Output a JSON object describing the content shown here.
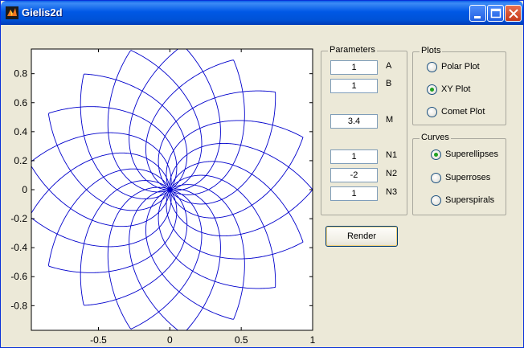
{
  "window": {
    "title": "Gielis2d"
  },
  "parameters": {
    "legend": "Parameters",
    "fields": [
      {
        "label": "A",
        "value": "1"
      },
      {
        "label": "B",
        "value": "1"
      },
      {
        "label": "M",
        "value": "3.4"
      },
      {
        "label": "N1",
        "value": "1"
      },
      {
        "label": "N2",
        "value": "-2"
      },
      {
        "label": "N3",
        "value": "1"
      }
    ]
  },
  "plots": {
    "legend": "Plots",
    "options": [
      "Polar Plot",
      "XY Plot",
      "Comet Plot"
    ],
    "selected": "XY Plot"
  },
  "curves": {
    "legend": "Curves",
    "options": [
      "Superellipses",
      "Superroses",
      "Superspirals"
    ],
    "selected": "Superellipses"
  },
  "render_label": "Render",
  "chart_data": {
    "type": "line",
    "title": "",
    "xlabel": "",
    "ylabel": "",
    "xlim": [
      -0.97,
      1.0
    ],
    "ylim": [
      -0.97,
      0.97
    ],
    "xticks": [
      "-0.5",
      "0",
      "0.5",
      "1"
    ],
    "yticks": [
      "0.8",
      "0.6",
      "0.4",
      "0.2",
      "0",
      "-0.2",
      "-0.4",
      "-0.6",
      "-0.8"
    ],
    "grid": false,
    "series_color": "#0000cc",
    "curve": {
      "m": 3.4,
      "a": 1,
      "b": 1,
      "n1": 1,
      "n2": -2,
      "n3": 1,
      "max_radius": 1.0
    }
  }
}
